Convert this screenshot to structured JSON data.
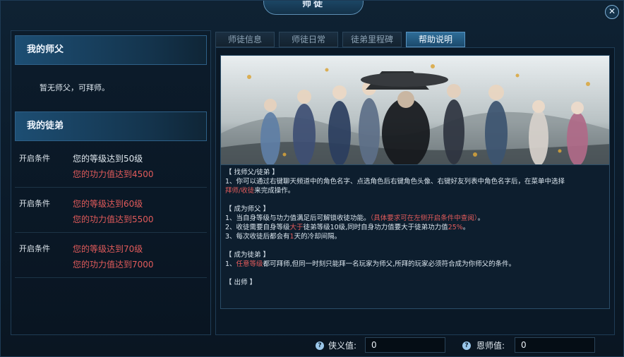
{
  "window": {
    "title": "师徒",
    "close_icon": "close-icon"
  },
  "master_section": {
    "title": "我的师父",
    "status": "暂无师父，可拜师。"
  },
  "apprentice_section": {
    "title": "我的徒弟",
    "conditions": [
      {
        "label": "开启条件",
        "level": "您的等级达到50级",
        "power": "您的功力值达到4500",
        "level_met": true,
        "power_met": false
      },
      {
        "label": "开启条件",
        "level": "您的等级达到60级",
        "power": "您的功力值达到5500",
        "level_met": false,
        "power_met": false
      },
      {
        "label": "开启条件",
        "level": "您的等级达到70级",
        "power": "您的功力值达到7000",
        "level_met": false,
        "power_met": false
      }
    ]
  },
  "tabs": [
    {
      "label": "师徒信息",
      "active": false
    },
    {
      "label": "师徒日常",
      "active": false
    },
    {
      "label": "徒弟里程碑",
      "active": false
    },
    {
      "label": "帮助说明",
      "active": true
    }
  ],
  "help": {
    "find_title": "【 找师父/徒弟 】",
    "find_line1": "1、你可以通过右键聊天频道中的角色名字、点选角色后右键角色头像、右键好友列表中角色名字后，在菜单中选择",
    "find_line2_hl": "拜师/收徒",
    "find_line2_rest": "来完成操作。",
    "master_title": "【 成为师父 】",
    "master_line1": "1、当自身等级与功力值满足后可解锁收徒功能。",
    "master_line1_hl": "（具体要求可在左侧开启条件中查阅）",
    "master_line1_end": "。",
    "master_line2_a": "2、收徒需要自身等级",
    "master_line2_hl1": "大于",
    "master_line2_b": "徒弟等级10级,同时自身功力值要大于徒弟功力值",
    "master_line2_hl2": "25%",
    "master_line2_c": "。",
    "master_line3_a": "3、每次收徒后都会有",
    "master_line3_hl": "1",
    "master_line3_b": "天的冷却间隔。",
    "apprentice_title": "【 成为徒弟 】",
    "apprentice_line1_a": "1、",
    "apprentice_line1_hl": "任意等级",
    "apprentice_line1_b": "都可拜师,但同一时刻只能拜一名玩家为师父,所拜的玩家必须符合成为你师父的条件。",
    "graduate_title": "【 出师 】"
  },
  "footer": {
    "chivalry_label": "侠义值:",
    "chivalry_value": "0",
    "gratitude_label": "恩师值:",
    "gratitude_value": "0",
    "help_icon": "?"
  },
  "colors": {
    "highlight": "#e25b5b",
    "accent": "#2e6d98"
  }
}
